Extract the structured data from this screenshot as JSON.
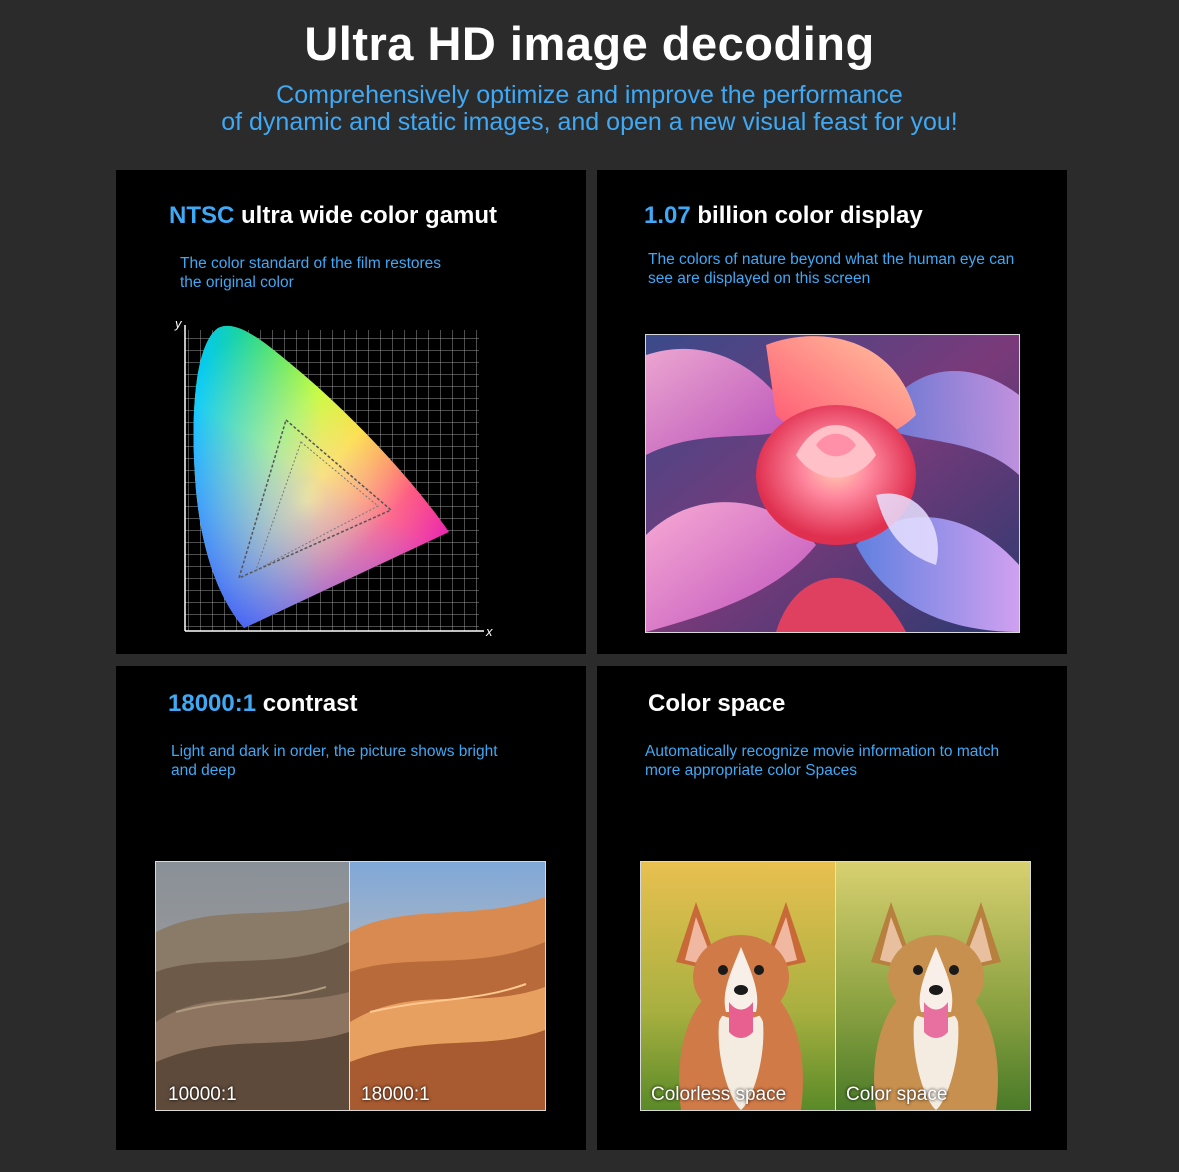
{
  "header": {
    "title": "Ultra HD image decoding",
    "subtitle_line1": "Comprehensively optimize and improve the performance",
    "subtitle_line2": "of dynamic and static images, and open a new visual feast for you!"
  },
  "panels": {
    "gamut": {
      "title_highlight": "NTSC",
      "title_rest": " ultra wide color gamut",
      "desc_line1": "The color standard of the film restores",
      "desc_line2": "the original color",
      "axis_y": "y",
      "axis_x": "x"
    },
    "billion": {
      "title_highlight": "1.07",
      "title_rest": " billion color display",
      "desc_line1": "The colors of nature beyond what the human eye can",
      "desc_line2": "see are displayed on this screen"
    },
    "contrast": {
      "title_highlight": "18000:1",
      "title_rest": " contrast",
      "desc_line1": "Light and dark in order, the picture shows bright",
      "desc_line2": "and deep",
      "left_label": "10000:1",
      "right_label": "18000:1"
    },
    "colorspace": {
      "title": "Color space",
      "desc_line1": "Automatically recognize movie information to match",
      "desc_line2": "more appropriate color Spaces",
      "left_label": "Colorless space",
      "right_label": "Color space"
    }
  },
  "colors": {
    "background": "#2b2b2b",
    "panel": "#000000",
    "accent": "#3fa9f5",
    "text": "#ffffff"
  }
}
